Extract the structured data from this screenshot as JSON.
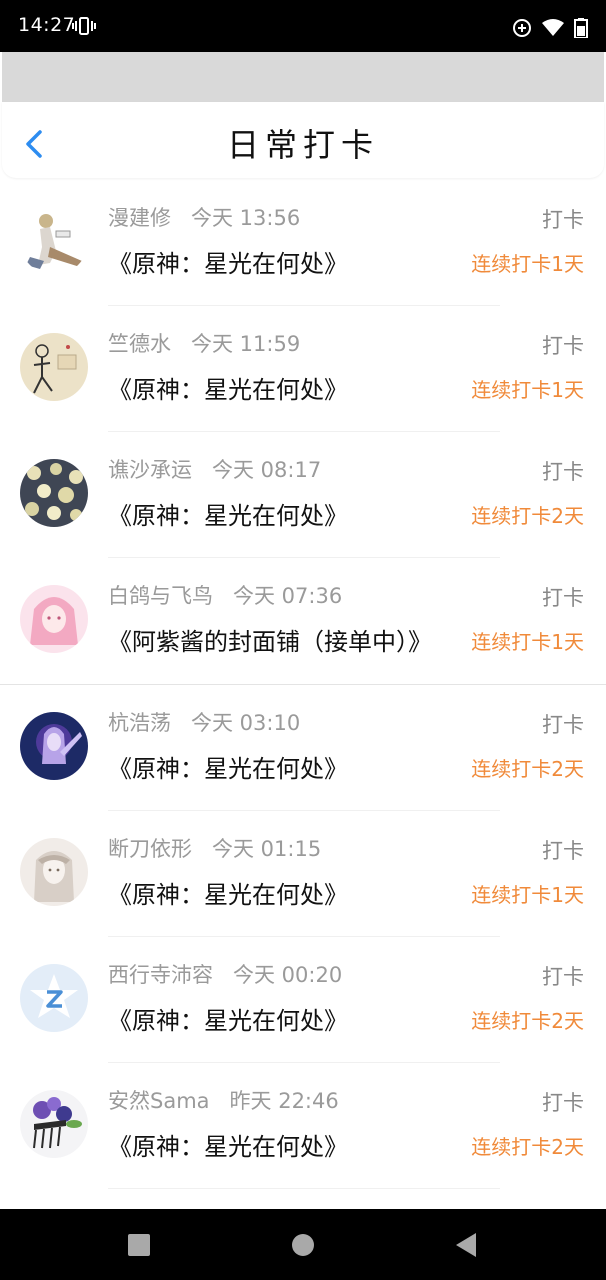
{
  "status_bar": {
    "time": "14:27"
  },
  "header": {
    "title": "日常打卡"
  },
  "checkins": [
    {
      "user": "漫建修",
      "time": "今天 13:56",
      "book": "《原神：星光在何处》",
      "action": "打卡",
      "streak": "连续打卡1天",
      "avatar": "character-avatar"
    },
    {
      "user": "竺德水",
      "time": "今天 11:59",
      "book": "《原神：星光在何处》",
      "action": "打卡",
      "streak": "连续打卡1天",
      "avatar": "sketch-avatar"
    },
    {
      "user": "谯沙承运",
      "time": "今天 08:17",
      "book": "《原神：星光在何处》",
      "action": "打卡",
      "streak": "连续打卡2天",
      "avatar": "floral-avatar"
    },
    {
      "user": "白鸽与飞鸟",
      "time": "今天 07:36",
      "book": "《阿紫酱的封面铺（接单中）》",
      "action": "打卡",
      "streak": "连续打卡1天",
      "avatar": "pink-anime-avatar"
    },
    {
      "user": "杭浩荡",
      "time": "今天 03:10",
      "book": "《原神：星光在何处》",
      "action": "打卡",
      "streak": "连续打卡2天",
      "avatar": "purple-fantasy-avatar"
    },
    {
      "user": "断刀依形",
      "time": "今天 01:15",
      "book": "《原神：星光在何处》",
      "action": "打卡",
      "streak": "连续打卡1天",
      "avatar": "girl-sketch-avatar"
    },
    {
      "user": "西行寺沛容",
      "time": "今天 00:20",
      "book": "《原神：星光在何处》",
      "action": "打卡",
      "streak": "连续打卡2天",
      "avatar": "default-qq-avatar"
    },
    {
      "user": "安然Sama",
      "time": "昨天 22:46",
      "book": "《原神：星光在何处》",
      "action": "打卡",
      "streak": "连续打卡2天",
      "avatar": "hair-ornament-avatar"
    }
  ],
  "colors": {
    "streak": "#f08a3a",
    "back_arrow": "#2d8cf0",
    "meta": "#9a9a9a"
  }
}
